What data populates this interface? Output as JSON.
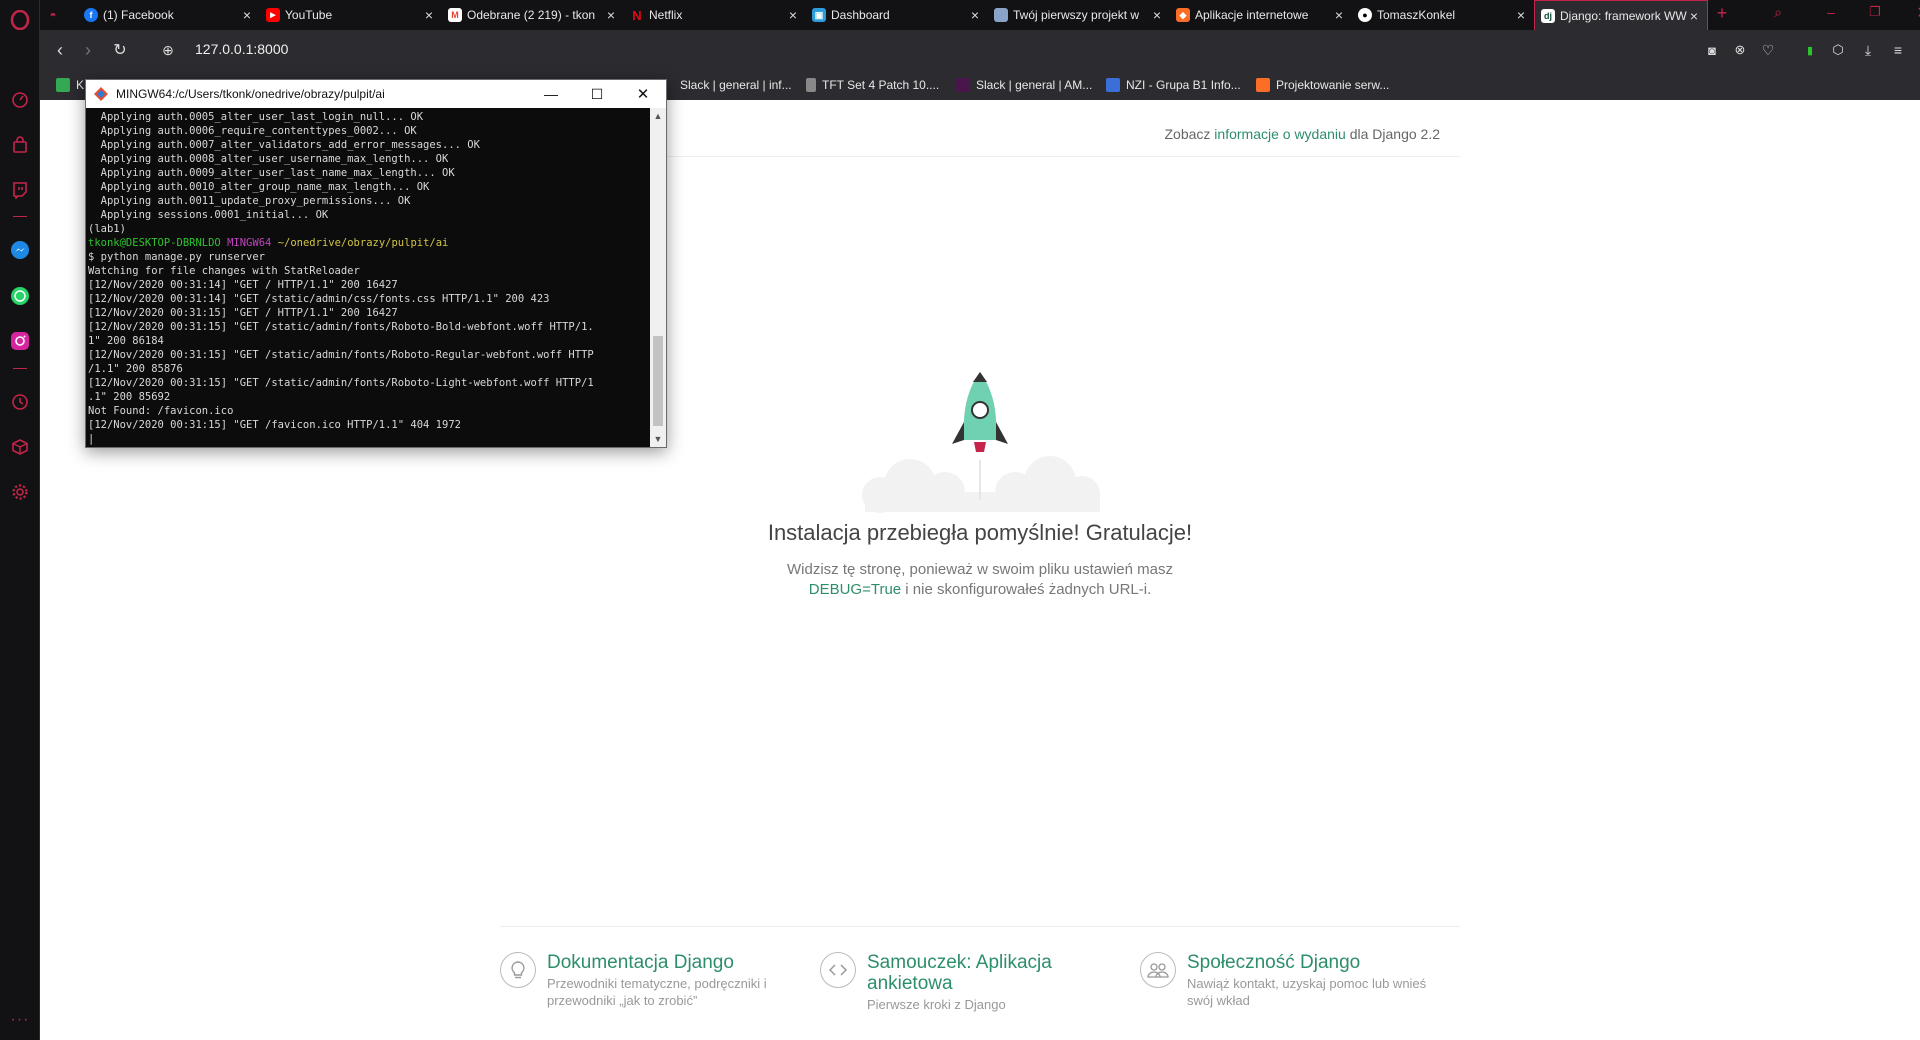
{
  "tabs": [
    {
      "label": "(1) Facebook",
      "icon": "facebook-icon",
      "color": "#1877f2"
    },
    {
      "label": "YouTube",
      "icon": "youtube-icon",
      "color": "#ff0000"
    },
    {
      "label": "Odebrane (2 219) - tkon",
      "icon": "gmail-icon",
      "color": "#ea4335"
    },
    {
      "label": "Netflix",
      "icon": "netflix-icon",
      "color": "#e50914"
    },
    {
      "label": "Dashboard",
      "icon": "dashboard-icon",
      "color": "#2d9cdb"
    },
    {
      "label": "Twój pierwszy projekt w",
      "icon": "page-icon",
      "color": "#8aa4c8"
    },
    {
      "label": "Aplikacje internetowe",
      "icon": "gitlab-icon",
      "color": "#fc6d26"
    },
    {
      "label": "TomaszKonkel",
      "icon": "github-icon",
      "color": "#ffffff"
    },
    {
      "label": "Django: framework WW",
      "icon": "django-icon",
      "color": "#0c4b33"
    }
  ],
  "address": {
    "url": "127.0.0.1:8000"
  },
  "bookmarks": [
    {
      "label": "K",
      "color": "#34a853"
    },
    {
      "label": "Slack | general | inf...",
      "color": "#4a154b"
    },
    {
      "label": "TFT Set 4 Patch 10....",
      "color": "#888888"
    },
    {
      "label": "Slack | general | AM...",
      "color": "#4a154b"
    },
    {
      "label": "NZI - Grupa B1 Info...",
      "color": "#3b6fd8"
    },
    {
      "label": "Projektowanie serw...",
      "color": "#fc6d26"
    }
  ],
  "terminal": {
    "title": "MINGW64:/c/Users/tkonk/onedrive/obrazy/pulpit/ai",
    "lines_before": [
      "  Applying auth.0005_alter_user_last_login_null... OK",
      "  Applying auth.0006_require_contenttypes_0002... OK",
      "  Applying auth.0007_alter_validators_add_error_messages... OK",
      "  Applying auth.0008_alter_user_username_max_length... OK",
      "  Applying auth.0009_alter_user_last_name_max_length... OK",
      "  Applying auth.0010_alter_group_name_max_length... OK",
      "  Applying auth.0011_update_proxy_permissions... OK",
      "  Applying sessions.0001_initial... OK",
      "(lab1)"
    ],
    "prompt_user": "tkonk@DESKTOP-DBRNLDO",
    "prompt_env": "MINGW64",
    "prompt_path": "~/onedrive/obrazy/pulpit/ai",
    "lines_after": [
      "$ python manage.py runserver",
      "Watching for file changes with StatReloader",
      "[12/Nov/2020 00:31:14] \"GET / HTTP/1.1\" 200 16427",
      "[12/Nov/2020 00:31:14] \"GET /static/admin/css/fonts.css HTTP/1.1\" 200 423",
      "[12/Nov/2020 00:31:15] \"GET / HTTP/1.1\" 200 16427",
      "[12/Nov/2020 00:31:15] \"GET /static/admin/fonts/Roboto-Bold-webfont.woff HTTP/1.",
      "1\" 200 86184",
      "[12/Nov/2020 00:31:15] \"GET /static/admin/fonts/Roboto-Regular-webfont.woff HTTP",
      "/1.1\" 200 85876",
      "[12/Nov/2020 00:31:15] \"GET /static/admin/fonts/Roboto-Light-webfont.woff HTTP/1",
      ".1\" 200 85692",
      "Not Found: /favicon.ico",
      "[12/Nov/2020 00:31:15] \"GET /favicon.ico HTTP/1.1\" 404 1972",
      "|"
    ]
  },
  "page": {
    "release_prefix": "Zobacz ",
    "release_link": "informacje o wydaniu",
    "release_suffix": " dla Django 2.2",
    "title": "Instalacja przebiegła pomyślnie! Gratulacje!",
    "desc_1": "Widzisz tę stronę, ponieważ w swoim pliku ustawień masz ",
    "desc_debug": "DEBUG=True",
    "desc_2": " i nie skonfigurowałeś żadnych URL-i.",
    "cards": [
      {
        "title": "Dokumentacja Django",
        "subtitle": "Przewodniki tematyczne, podręczniki i przewodniki „jak to zrobić”",
        "icon": "lightbulb-icon"
      },
      {
        "title": "Samouczek: Aplikacja ankietowa",
        "subtitle": "Pierwsze kroki z Django",
        "icon": "code-icon"
      },
      {
        "title": "Społeczność Django",
        "subtitle": "Nawiąż kontakt, uzyskaj pomoc lub wnieś swój wkład",
        "icon": "community-icon"
      }
    ]
  },
  "colors": {
    "accent": "#c4244a",
    "django_green": "#2d8e6a",
    "rocket": "#6fd1b1"
  }
}
